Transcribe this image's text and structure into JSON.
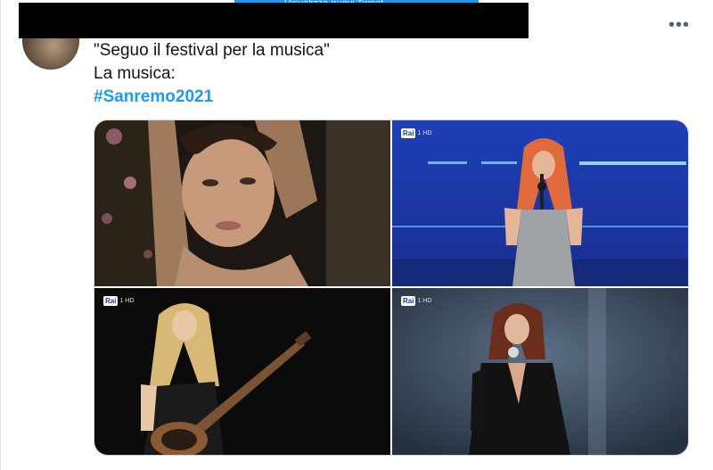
{
  "tweet": {
    "more_label": "•••",
    "banner_text": "Visualizza nuovi Tweet",
    "text_line1": "\"Seguo il festival per la musica\"",
    "text_line2": "La musica:",
    "hashtag": "#Sanremo2021"
  },
  "media": {
    "tv_logo": "Rai",
    "tv_logo_suffix": "1 HD",
    "photos": [
      {
        "name": "photo-woman-lying-among-flowers",
        "has_logo": false
      },
      {
        "name": "photo-singer-red-hair-stage",
        "has_logo": true
      },
      {
        "name": "photo-guitarist-performing",
        "has_logo": true
      },
      {
        "name": "photo-singer-black-jacket",
        "has_logo": true
      }
    ]
  },
  "colors": {
    "hashtag": "#1d9bf0",
    "text": "#0f1419",
    "muted": "#536471",
    "border": "#cfd9de",
    "redaction": "#000000"
  }
}
